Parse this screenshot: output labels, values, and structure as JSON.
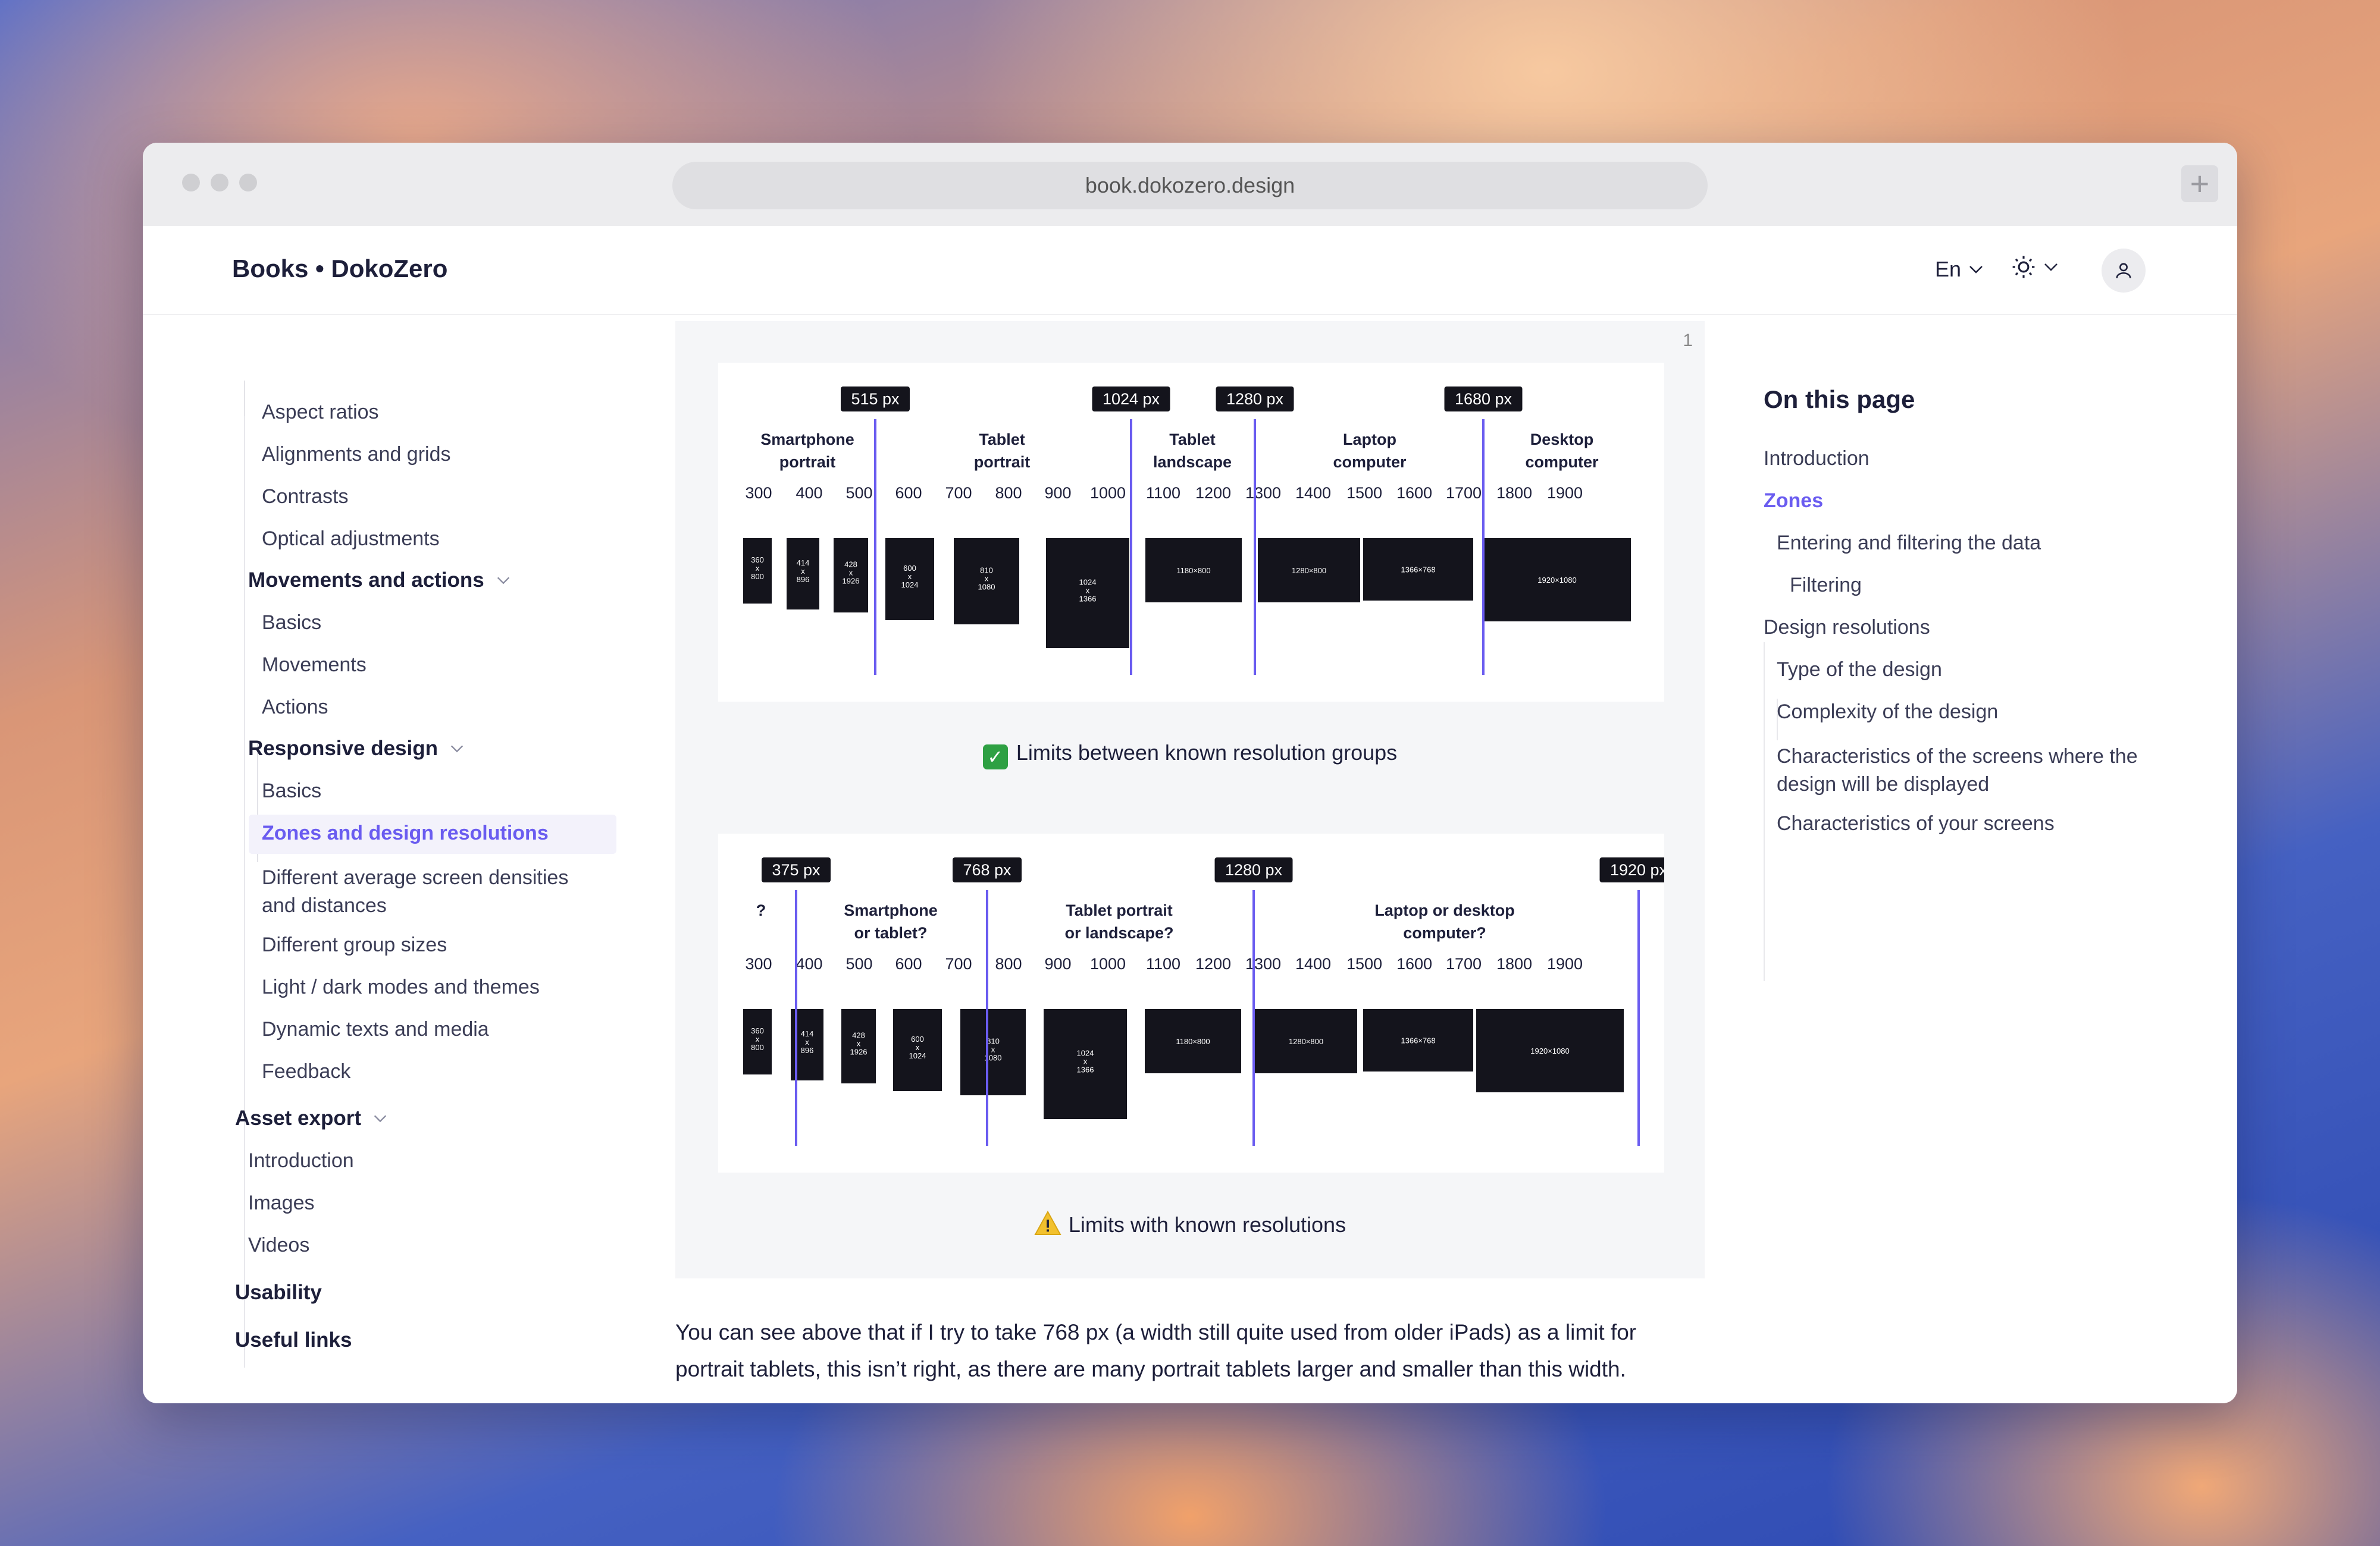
{
  "browser": {
    "url": "book.dokozero.design"
  },
  "header": {
    "brand": "Books • DokoZero",
    "language": "En"
  },
  "sidebar": {
    "top_items": [
      "Aspect ratios",
      "Alignments and grids",
      "Contrasts",
      "Optical adjustments"
    ],
    "movements": {
      "title": "Movements and actions",
      "items": [
        "Basics",
        "Movements",
        "Actions"
      ]
    },
    "responsive": {
      "title": "Responsive design",
      "items": [
        "Basics",
        "Zones and design resolutions",
        "Different average screen densities and distances",
        "Different group sizes",
        "Light / dark modes and themes",
        "Dynamic texts and media",
        "Feedback"
      ]
    },
    "asset_export": {
      "title": "Asset export",
      "items": [
        "Introduction",
        "Images",
        "Videos"
      ]
    },
    "usability": "Usability",
    "useful_links": "Useful links",
    "accent_color": "#6a5cf0"
  },
  "figure": {
    "number": "1",
    "chart1": {
      "limits": [
        "515 px",
        "1024 px",
        "1280 px",
        "1680 px"
      ],
      "groups": [
        "Smartphone portrait",
        "Tablet portrait",
        "Tablet landscape",
        "Laptop computer",
        "Desktop computer"
      ],
      "ticks": [
        "300",
        "400",
        "500",
        "600",
        "700",
        "800",
        "900",
        "1000",
        "1100",
        "1200",
        "1300",
        "1400",
        "1500",
        "1600",
        "1700",
        "1800",
        "1900"
      ],
      "screens": [
        "360 x 800",
        "414 x 896",
        "428 x 1926",
        "600 x 1024",
        "810 x 1080",
        "1024 x 1366",
        "1180×800",
        "1280×800",
        "1366×768",
        "1920×1080"
      ],
      "caption": "Limits between known resolution groups"
    },
    "chart2": {
      "limits": [
        "375 px",
        "768 px",
        "1280 px",
        "1920 px"
      ],
      "groups": [
        "?",
        "Smartphone or tablet?",
        "Tablet portrait or landscape?",
        "Laptop or desktop computer?"
      ],
      "ticks": [
        "300",
        "400",
        "500",
        "600",
        "700",
        "800",
        "900",
        "1000",
        "1100",
        "1200",
        "1300",
        "1400",
        "1500",
        "1600",
        "1700",
        "1800",
        "1900"
      ],
      "screens": [
        "360 x 800",
        "414 x 896",
        "428 x 1926",
        "600 x 1024",
        "810 x 1080",
        "1024 x 1366",
        "1180×800",
        "1280×800",
        "1366×768",
        "1920×1080"
      ],
      "caption": "Limits with known resolutions"
    }
  },
  "paragraph": "You can see above that if I try to take 768 px (a width still quite used from older iPads) as a limit for portrait tablets, this isn’t right, as there are many portrait tablets larger and smaller than this width.",
  "toc": {
    "title": "On this page",
    "items": [
      "Introduction",
      "Zones",
      "Entering and filtering the data",
      "Filtering",
      "Design resolutions",
      "Type of the design",
      "Complexity of the design",
      "Characteristics of the screens where the design will be displayed",
      "Characteristics of your screens"
    ]
  }
}
